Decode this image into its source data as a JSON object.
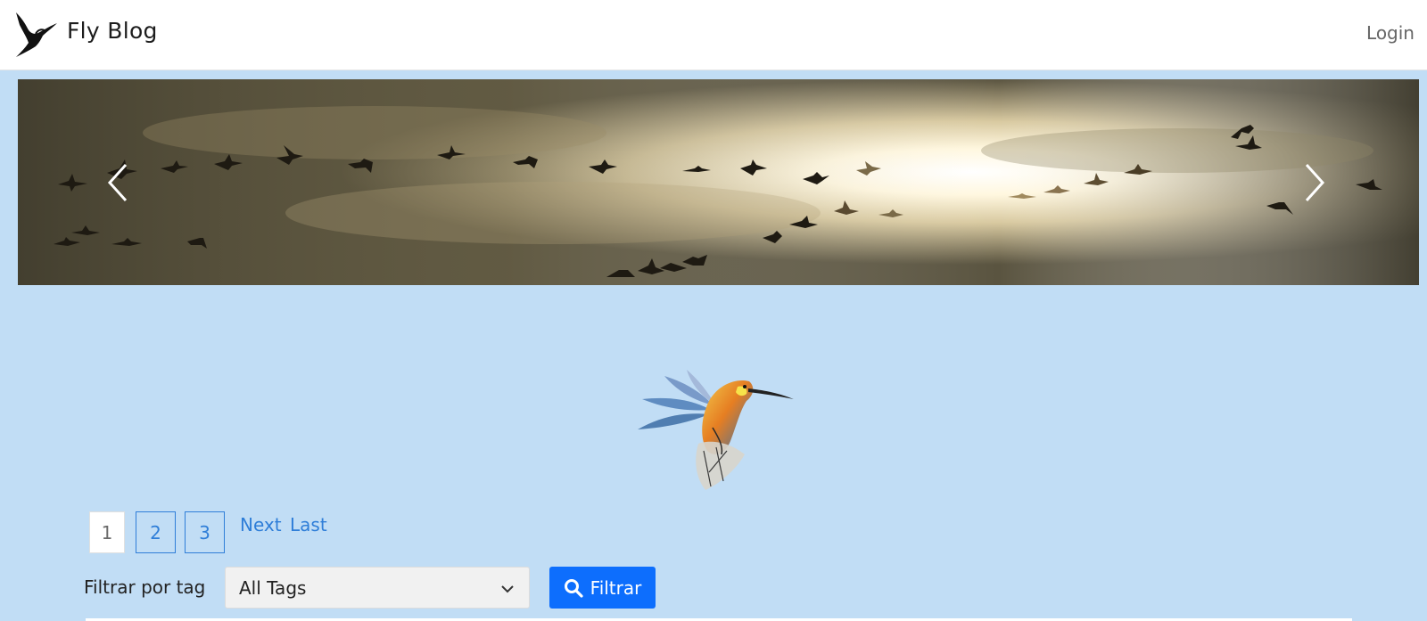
{
  "navbar": {
    "brand_name": "Fly Blog",
    "login_label": "Login"
  },
  "carousel": {
    "prev_icon": "chevron-left-icon",
    "next_icon": "chevron-right-icon"
  },
  "pagination": {
    "pages": [
      "1",
      "2",
      "3"
    ],
    "current": "1",
    "next_label": "Next",
    "last_label": "Last"
  },
  "filter": {
    "label": "Filtrar por tag",
    "select_value": "All Tags",
    "button_label": "Filtrar",
    "button_icon": "search-icon"
  },
  "colors": {
    "page_bg": "#c1ddf5",
    "link": "#2f7ed8",
    "primary_button": "#0d6efd"
  }
}
